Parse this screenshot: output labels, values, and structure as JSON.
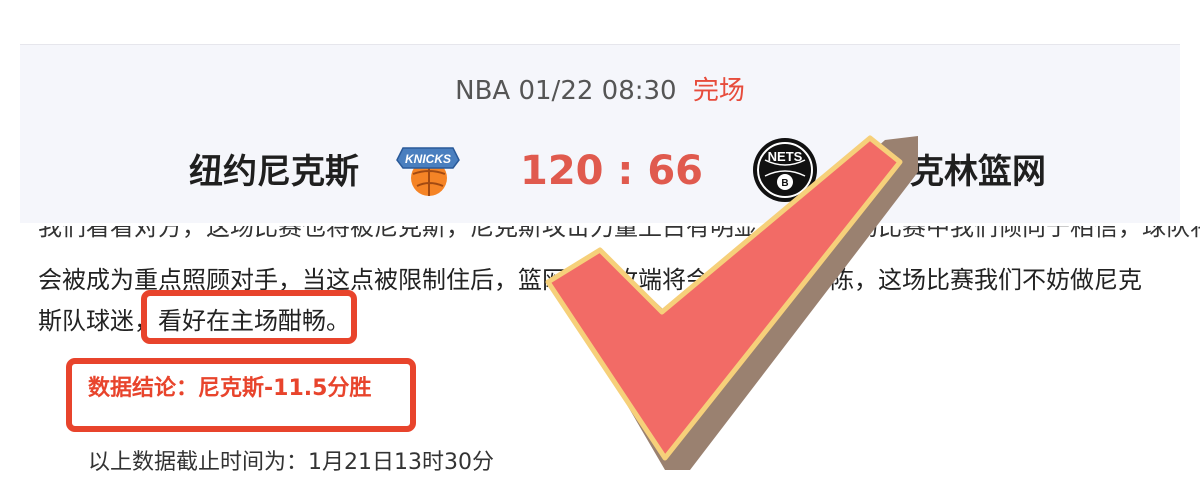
{
  "match": {
    "league": "NBA",
    "datetime": "01/22 08:30",
    "status": "完场",
    "home_team": "纽约尼克斯",
    "away_team": "布鲁克林篮网",
    "score_display": "120 : 66",
    "home_logo_text": "KNICKS",
    "away_logo_text": "NETS",
    "colors": {
      "status": "#e74c3c",
      "score": "#e05a4e"
    }
  },
  "article": {
    "cut_line": "我们看看对方，这场比赛也将被尼克斯，尼克斯攻击力量上占有明显上风，这场比赛中我们倾向于相信，球队将",
    "line_1": "会被成为重点照顾对手，当这点被限制住后，篮网的进攻端将会变得乏善可陈，这场比赛我们不妨做尼克",
    "line_2_prefix": "斯队球迷，",
    "line_2_highlight": "看好在主场酣畅。",
    "conclusion": "数据结论：尼克斯-11.5分胜",
    "footnote": "以上数据截止时间为：1月21日13时30分"
  },
  "overlay": {
    "icon": "checkmark-icon",
    "colors": {
      "fill": "#f26b66",
      "border": "#f6d07a",
      "shadow": "#9a8170",
      "highlight_box": "#e8442c"
    }
  }
}
